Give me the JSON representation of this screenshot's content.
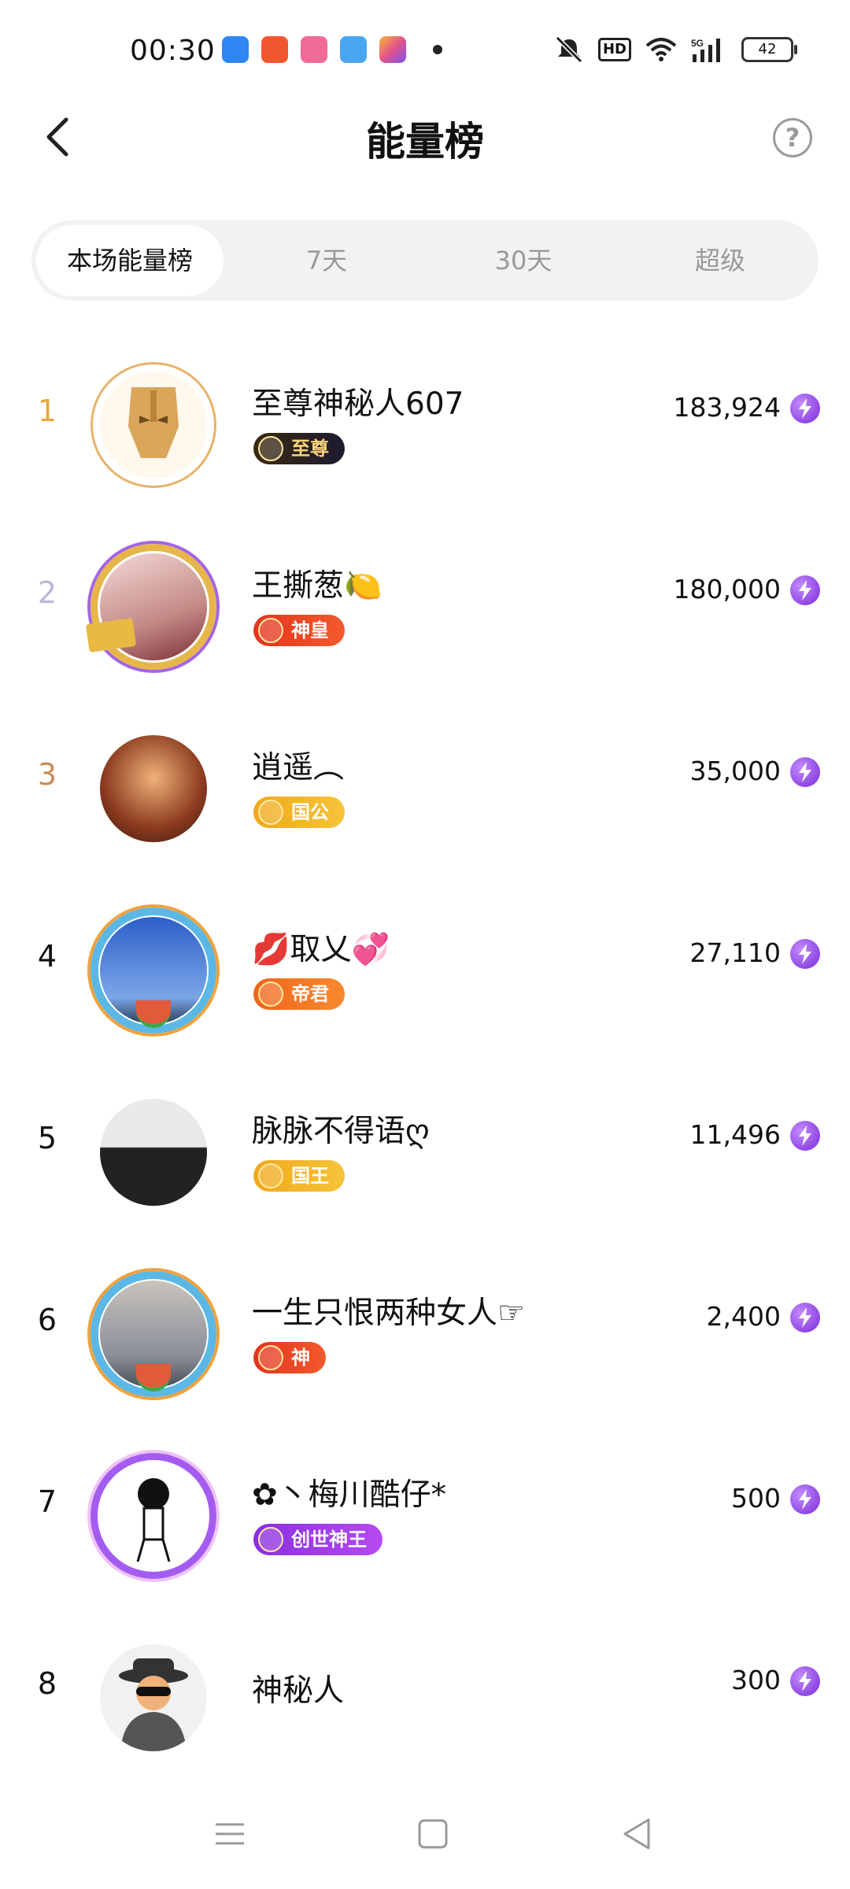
{
  "status_bar": {
    "time": "00:30",
    "battery": "42"
  },
  "header": {
    "title": "能量榜",
    "help_symbol": "?"
  },
  "tabs": [
    {
      "label": "本场能量榜",
      "active": true
    },
    {
      "label": "7天",
      "active": false
    },
    {
      "label": "30天",
      "active": false
    },
    {
      "label": "超级",
      "active": false
    }
  ],
  "ranking": [
    {
      "rank": "1",
      "name": "至尊神秘人607",
      "badge": "至尊",
      "score": "183,924",
      "rank_color": "#e8a93a"
    },
    {
      "rank": "2",
      "name": "王撕葱🍋",
      "badge": "神皇",
      "score": "180,000",
      "rank_color": "#b9b7d9"
    },
    {
      "rank": "3",
      "name": "逍遥︵",
      "badge": "国公",
      "score": "35,000",
      "rank_color": "#c98c57"
    },
    {
      "rank": "4",
      "name": "💋取乂💞",
      "badge": "帝君",
      "score": "27,110",
      "rank_color": "#111111"
    },
    {
      "rank": "5",
      "name": "脉脉不得语ღ",
      "badge": "国王",
      "score": "11,496",
      "rank_color": "#111111"
    },
    {
      "rank": "6",
      "name": "一生只恨两种女人☞",
      "badge": "神",
      "score": "2,400",
      "rank_color": "#111111"
    },
    {
      "rank": "7",
      "name": "✿丶梅川酷仔*",
      "badge": "创世神王",
      "score": "500",
      "rank_color": "#111111"
    },
    {
      "rank": "8",
      "name": "神秘人",
      "badge": "",
      "score": "300",
      "rank_color": "#111111"
    }
  ],
  "icons": {
    "back": "chevron-left-icon",
    "help": "question-circle-icon",
    "energy": "lightning-icon",
    "nav": [
      "menu-icon",
      "home-square-icon",
      "back-triangle-icon"
    ]
  },
  "colors": {
    "accent_purple": "#8a3ff0",
    "tab_bg": "#f2f2f2",
    "inactive_text": "#9a9a9a"
  }
}
